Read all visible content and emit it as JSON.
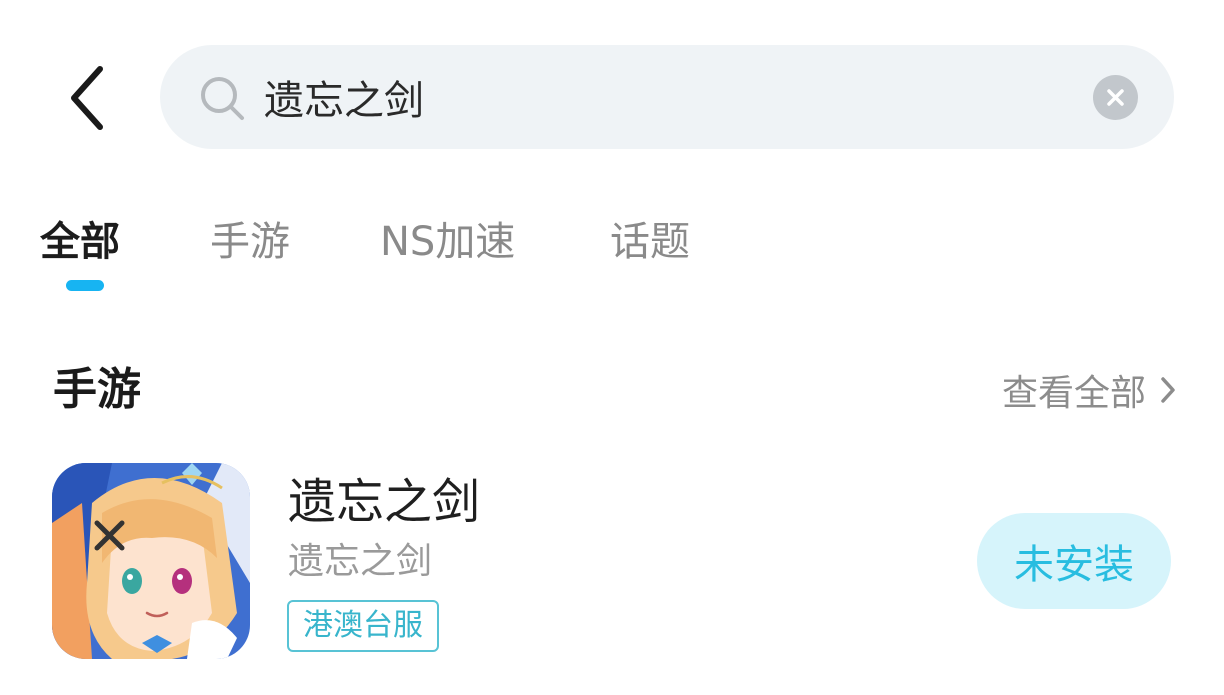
{
  "search": {
    "value": "遗忘之剑"
  },
  "tabs": [
    {
      "label": "全部"
    },
    {
      "label": "手游"
    },
    {
      "label": "NS加速"
    },
    {
      "label": "话题"
    }
  ],
  "section": {
    "title": "手游",
    "see_all_label": "查看全部"
  },
  "app": {
    "name": "遗忘之剑",
    "subtitle": "遗忘之剑",
    "tag": "港澳台服",
    "install_label": "未安装"
  },
  "colors": {
    "accent": "#17b4f2",
    "search_bg": "#eff3f6",
    "tag_border": "#58c3d5",
    "install_bg": "#d6f4fb",
    "install_text": "#28bde0"
  },
  "icons": {
    "back": "chevron-left-icon",
    "search": "search-icon",
    "clear": "close-icon",
    "see_all": "chevron-right-icon"
  }
}
